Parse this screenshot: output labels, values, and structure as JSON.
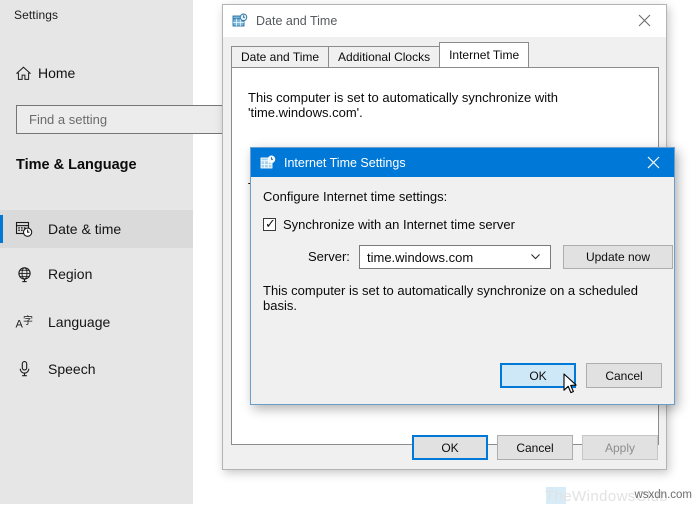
{
  "settings": {
    "title": "Settings",
    "home_label": "Home",
    "home_icon": "home-icon",
    "search_placeholder": "Find a setting",
    "category_title": "Time & Language",
    "accent_color": "#0078d7",
    "nav_items": [
      {
        "label": "Date & time",
        "icon": "calendar-clock-icon",
        "selected": true
      },
      {
        "label": "Region",
        "icon": "globe-icon",
        "selected": false
      },
      {
        "label": "Language",
        "icon": "language-icon",
        "selected": false
      },
      {
        "label": "Speech",
        "icon": "microphone-icon",
        "selected": false
      }
    ]
  },
  "datetime_dialog": {
    "title": "Date and Time",
    "icon": "date-time-icon",
    "close_icon": "close-icon",
    "tabs": [
      {
        "label": "Date and Time",
        "active": false
      },
      {
        "label": "Additional Clocks",
        "active": false
      },
      {
        "label": "Internet Time",
        "active": true
      }
    ],
    "content_line_1": "This computer is set to automatically synchronize with 'time.windows.com'.",
    "content_line_2": "T",
    "buttons": {
      "ok": "OK",
      "cancel": "Cancel",
      "apply": "Apply"
    }
  },
  "internet_time_settings": {
    "title": "Internet Time Settings",
    "icon": "date-time-icon",
    "close_icon": "close-icon",
    "heading": "Configure Internet time settings:",
    "sync_checkbox_label": "Synchronize with an Internet time server",
    "sync_checkbox_checked": true,
    "checkbox_glyph": "✓",
    "server_label": "Server:",
    "server_value": "time.windows.com",
    "server_chevron_icon": "chevron-down-icon",
    "update_now_label": "Update now",
    "status_text": "This computer is set to automatically synchronize on a scheduled basis.",
    "buttons": {
      "ok": "OK",
      "cancel": "Cancel"
    },
    "titlebar_color": "#0078d7"
  },
  "watermarks": {
    "faint": "TheWindowsClub",
    "corner": "wsxdn.com"
  }
}
